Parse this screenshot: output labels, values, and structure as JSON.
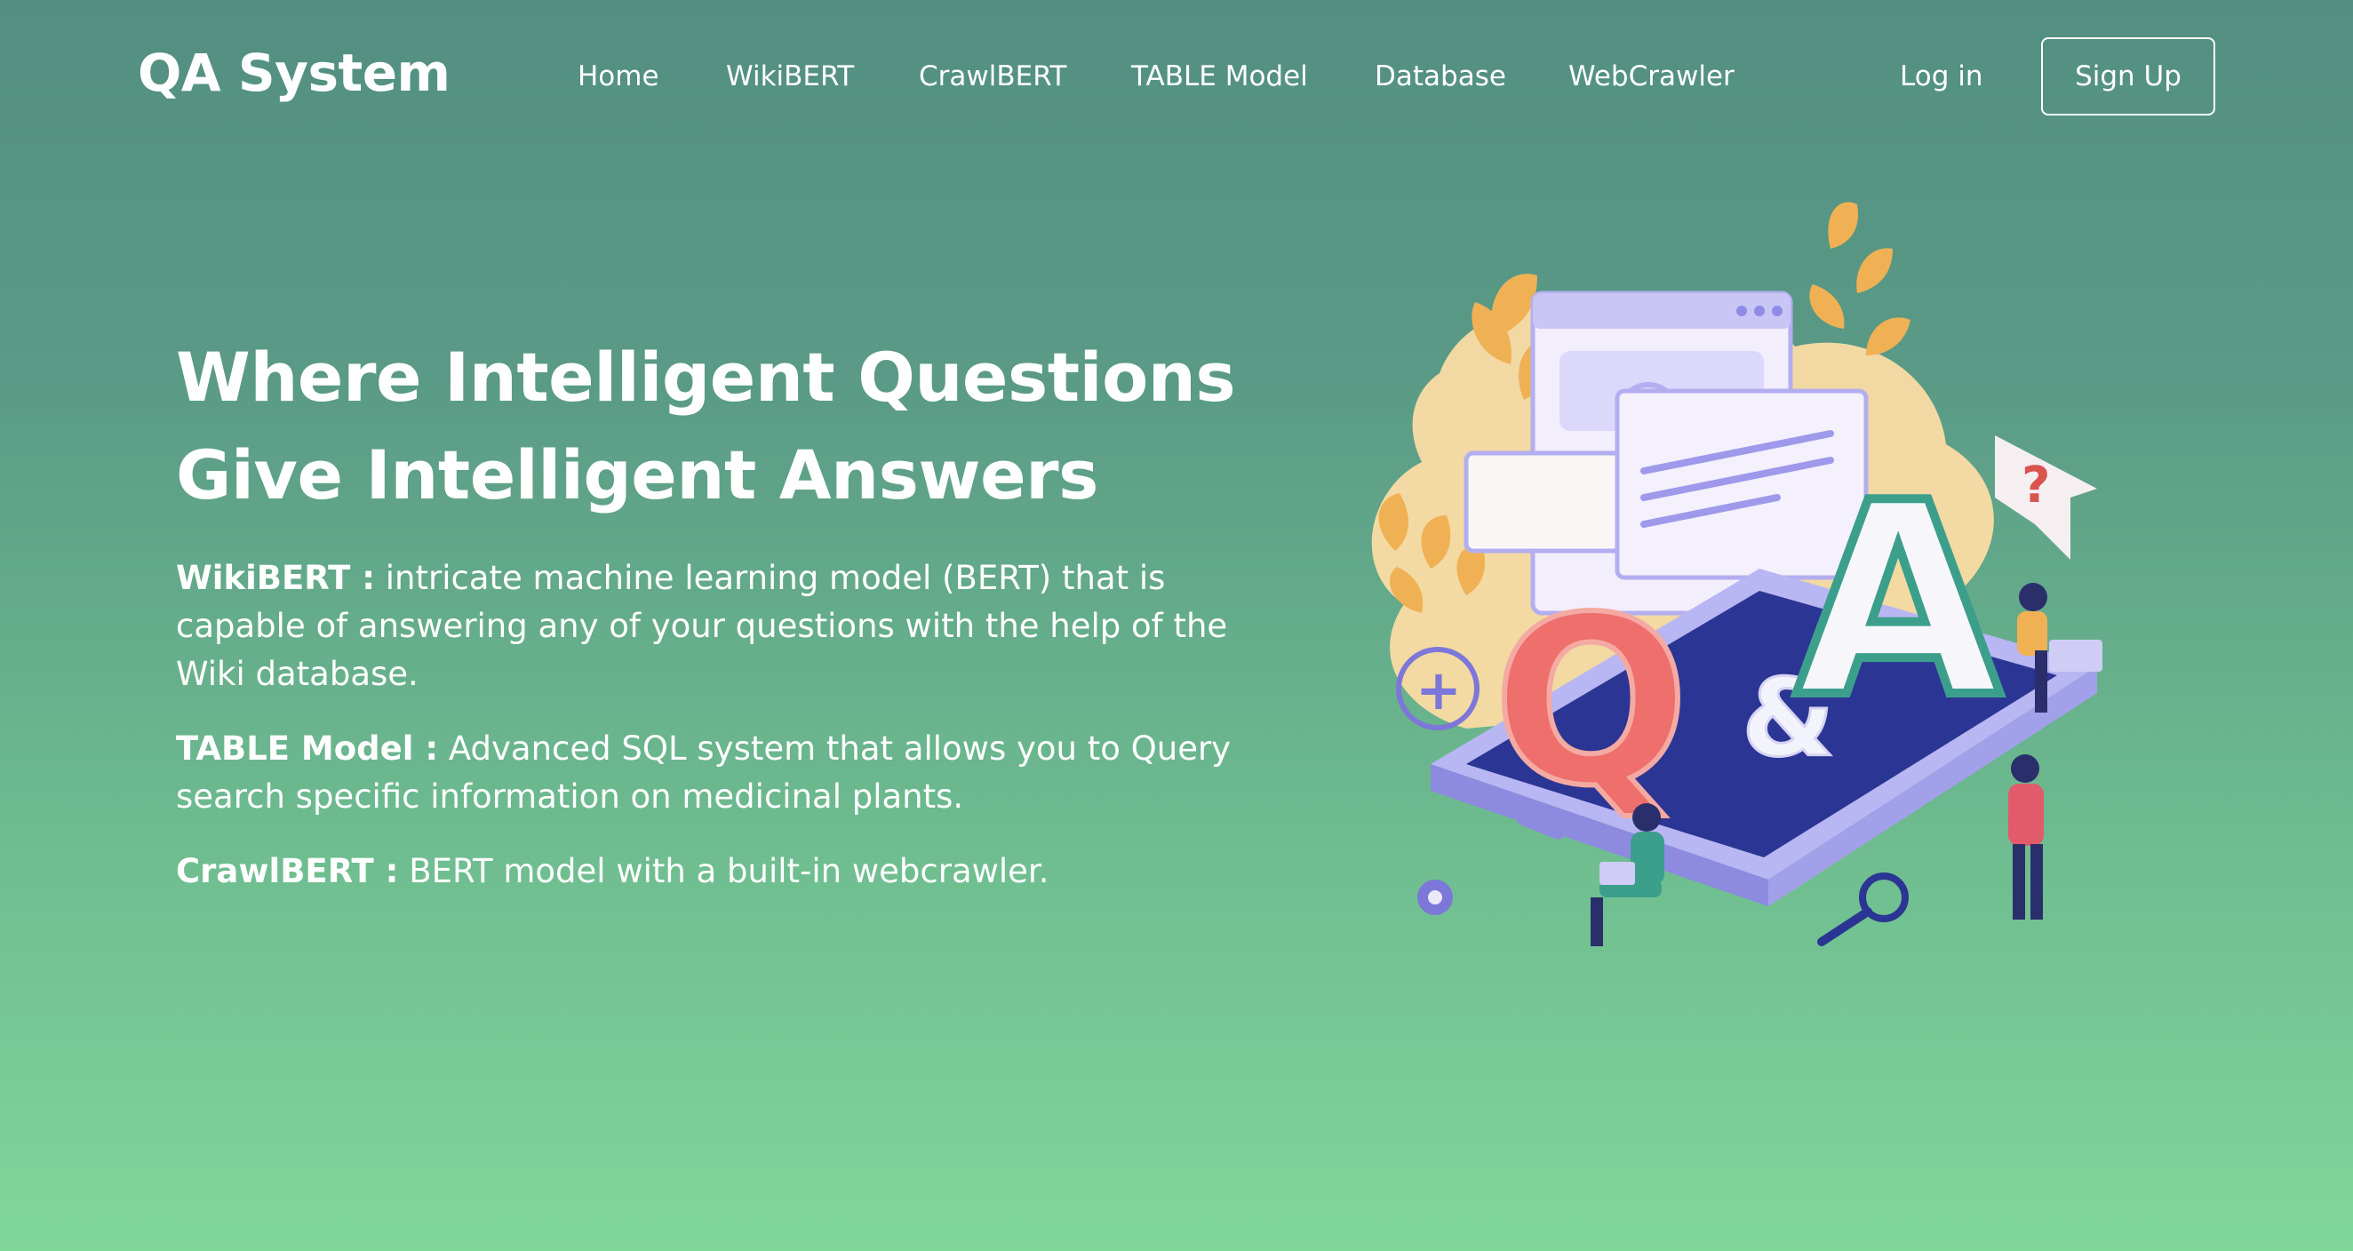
{
  "brand": "QA System",
  "nav": {
    "items": [
      {
        "label": "Home"
      },
      {
        "label": "WikiBERT"
      },
      {
        "label": "CrawlBERT"
      },
      {
        "label": "TABLE Model"
      },
      {
        "label": "Database"
      },
      {
        "label": "WebCrawler"
      }
    ],
    "login": "Log in",
    "signup": "Sign Up"
  },
  "hero": {
    "title_line1": "Where Intelligent Questions",
    "title_line2": "Give Intelligent Answers",
    "items": [
      {
        "term": "WikiBERT :",
        "text": " intricate machine learning model (BERT) that is capable of answering any of your questions with the help of the Wiki database."
      },
      {
        "term": "TABLE Model :",
        "text": " Advanced SQL system that allows you to Query search specific information on medicinal plants."
      },
      {
        "term": "CrawlBERT :",
        "text": " BERT model with a built-in webcrawler."
      }
    ]
  },
  "illustration": {
    "letter_q": "Q",
    "letter_amp": "&",
    "letter_a": "A",
    "question_mark": "?",
    "plus": "+"
  },
  "colors": {
    "bg_top": "#538f81",
    "bg_bottom": "#80d79a",
    "phone_screen": "#2b3593",
    "phone_body": "#b8b6f3",
    "q_letter": "#ee6f6c",
    "a_letter": "#3c9f8c",
    "leaf": "#f0b155",
    "blob": "#fbdca4"
  }
}
